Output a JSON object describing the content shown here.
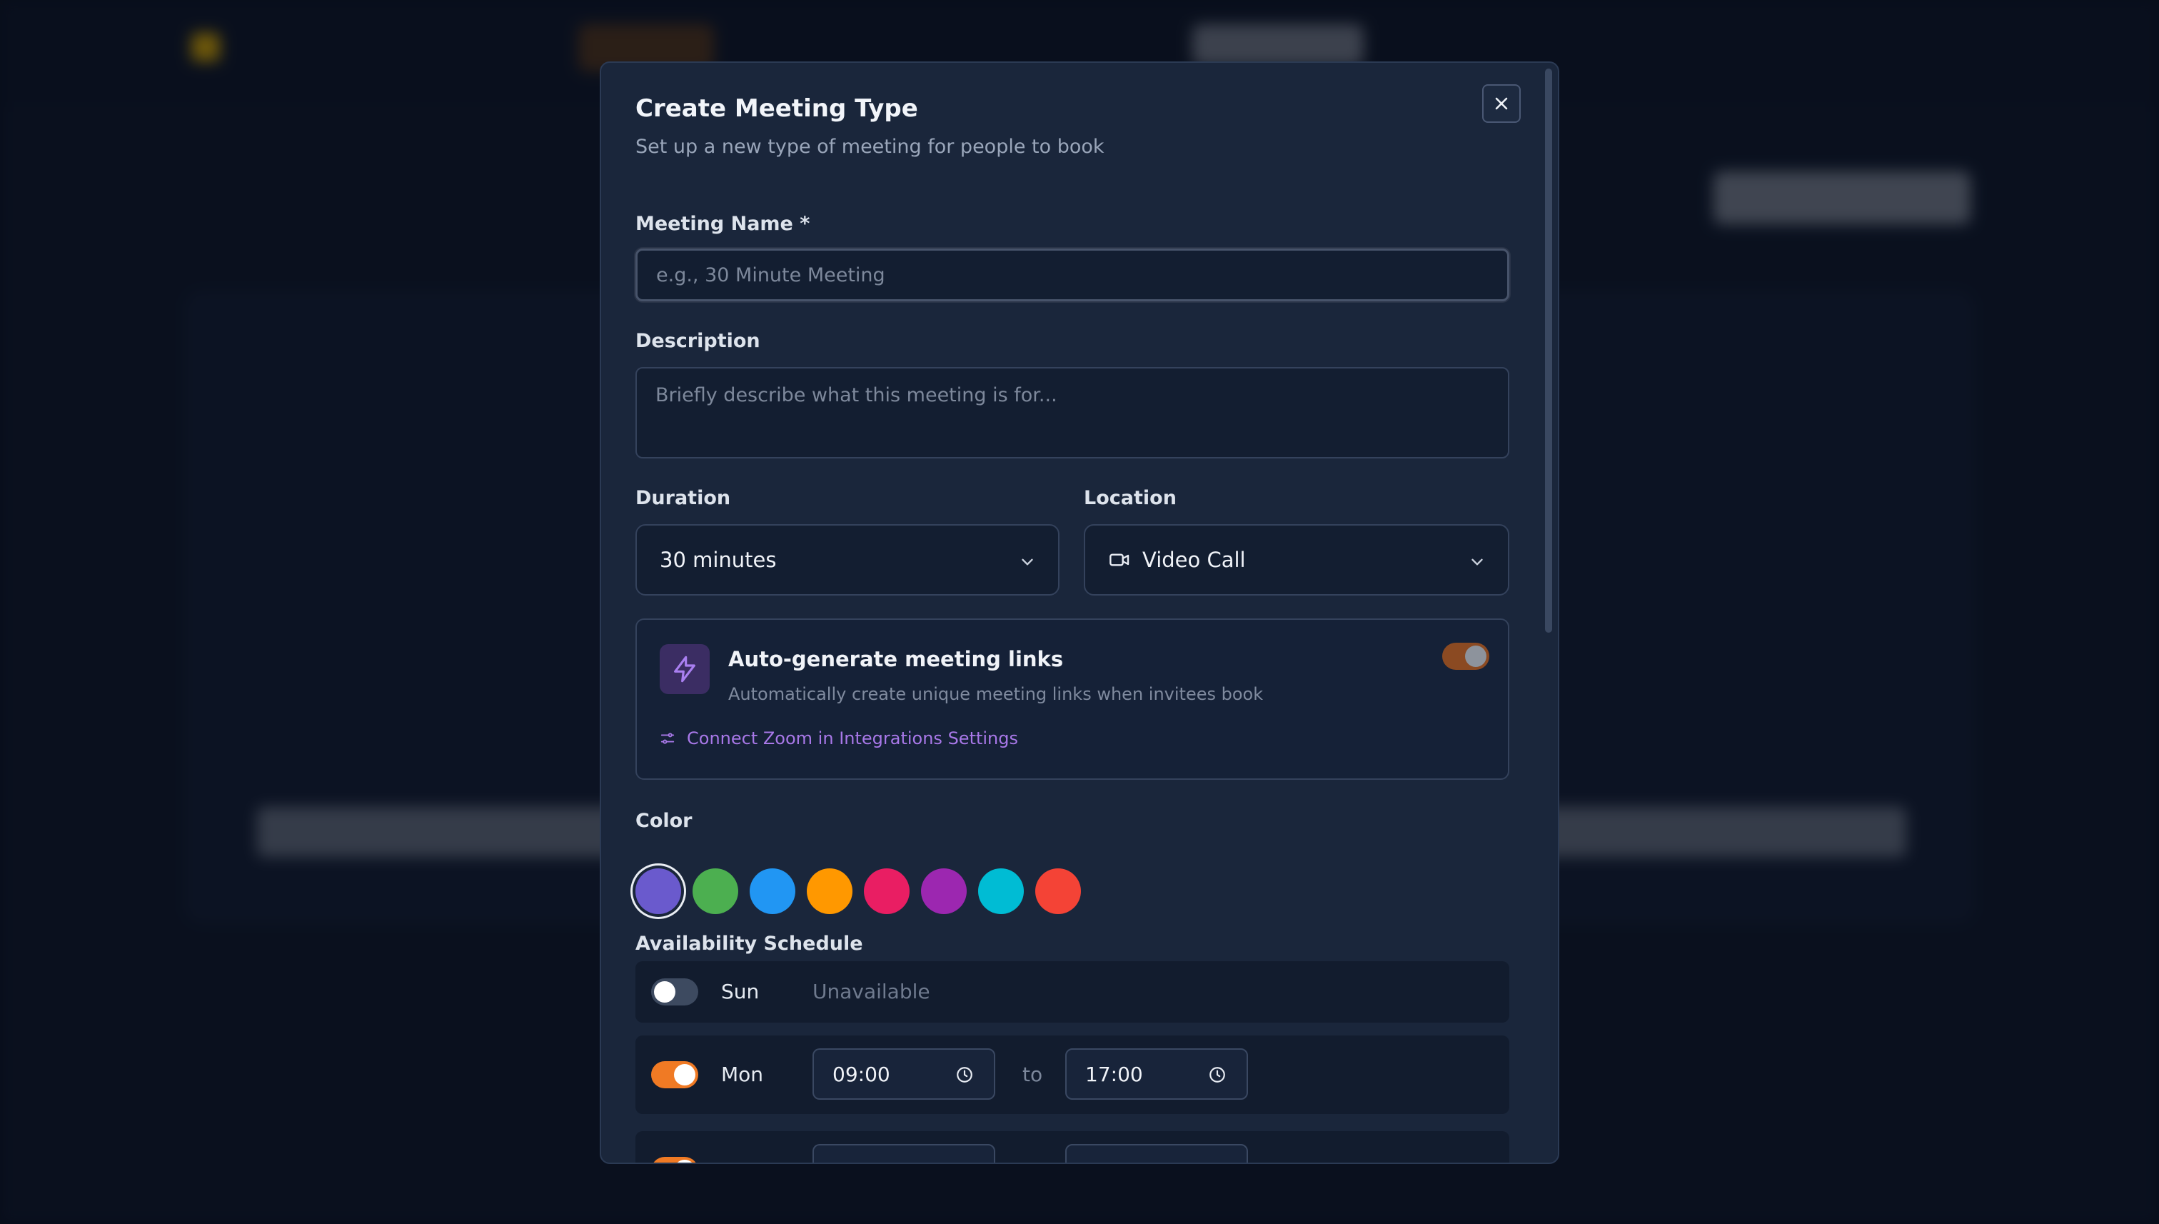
{
  "background": {
    "nav_items": [
      "",
      "",
      "",
      ""
    ],
    "title": "",
    "subtitle": ""
  },
  "modal": {
    "title": "Create Meeting Type",
    "subtitle": "Set up a new type of meeting for people to book",
    "close_icon": "close-icon"
  },
  "form": {
    "name_label": "Meeting Name *",
    "name_placeholder": "e.g., 30 Minute Meeting",
    "description_label": "Description",
    "description_placeholder": "Briefly describe what this meeting is for...",
    "duration_label": "Duration",
    "duration_value": "30 minutes",
    "location_label": "Location",
    "location_value": "Video Call",
    "location_icon": "video-camera-icon"
  },
  "auto_links": {
    "icon": "lightning-bolt-icon",
    "title": "Auto-generate meeting links",
    "description": "Automatically create unique meeting links when invitees book",
    "enabled": true,
    "link_text": "Connect Zoom in Integrations Settings",
    "link_icon": "settings-sliders-icon"
  },
  "color": {
    "label": "Color",
    "options": [
      "#6a5acd",
      "#4caf50",
      "#2196f3",
      "#ff9800",
      "#e91e63",
      "#9c27b0",
      "#00bcd4",
      "#f44336"
    ],
    "selected_index": 0
  },
  "availability": {
    "label": "Availability Schedule",
    "days": [
      {
        "day": "Sun",
        "enabled": false,
        "status": "Unavailable"
      },
      {
        "day": "Mon",
        "enabled": true,
        "start": "09:00",
        "end": "17:00",
        "separator": "to"
      }
    ]
  },
  "colors": {
    "accent_orange": "#f07a24",
    "link_purple": "#a878e8",
    "modal_bg": "#1a263b"
  }
}
